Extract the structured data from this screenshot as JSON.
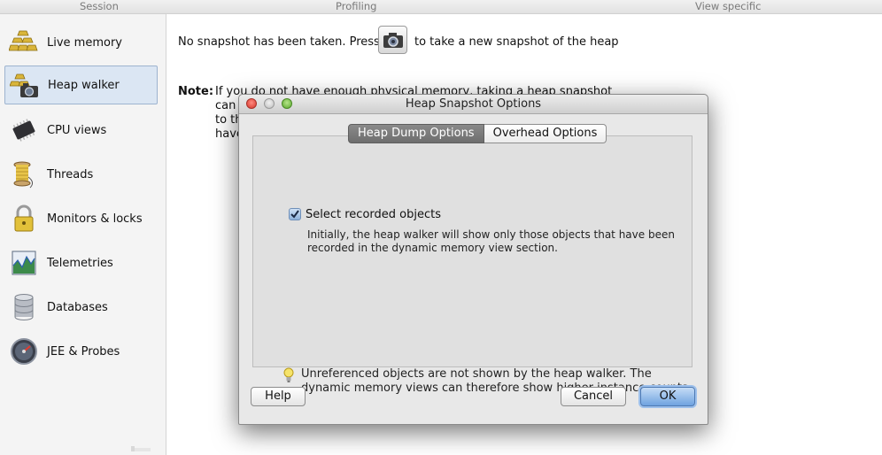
{
  "header": {
    "sections": [
      "Session",
      "Profiling",
      "View specific"
    ]
  },
  "sidebar": {
    "items": [
      {
        "label": "Live memory",
        "icon": "gold-bars-icon",
        "selected": false
      },
      {
        "label": "Heap walker",
        "icon": "heap-walker-icon",
        "selected": true
      },
      {
        "label": "CPU views",
        "icon": "cpu-chip-icon",
        "selected": false
      },
      {
        "label": "Threads",
        "icon": "thread-spool-icon",
        "selected": false
      },
      {
        "label": "Monitors & locks",
        "icon": "padlock-icon",
        "selected": false
      },
      {
        "label": "Telemetries",
        "icon": "telemetry-chart-icon",
        "selected": false
      },
      {
        "label": "Databases",
        "icon": "database-icon",
        "selected": false
      },
      {
        "label": "JEE & Probes",
        "icon": "probe-gauge-icon",
        "selected": false
      }
    ]
  },
  "main": {
    "message_before": "No snapshot has been taken. Press",
    "message_after": "to take a new snapshot of the heap",
    "snapshot_button_icon": "camera-icon",
    "note_label": "Note:",
    "note_lines": [
      "If you do not have enough physical memory, taking a heap snapshot",
      "can",
      "to th",
      "have"
    ]
  },
  "dialog": {
    "title": "Heap Snapshot Options",
    "tabs": [
      {
        "label": "Heap Dump Options",
        "active": true
      },
      {
        "label": "Overhead Options",
        "active": false
      }
    ],
    "checkbox": {
      "label": "Select recorded objects",
      "checked": true
    },
    "description": "Initially, the heap walker will show only those objects that have been recorded in the dynamic memory view section.",
    "hint": "Unreferenced objects are not shown by the heap walker. The dynamic memory views can therefore show higher instance counts.",
    "buttons": {
      "help": "Help",
      "cancel": "Cancel",
      "ok": "OK"
    }
  },
  "colors": {
    "selection": "#dbe6f3",
    "default_button": "#6fa3e0",
    "active_tab": "#7b7b7b",
    "close_light": "#d6362b",
    "zoom_light": "#5aa82d"
  }
}
